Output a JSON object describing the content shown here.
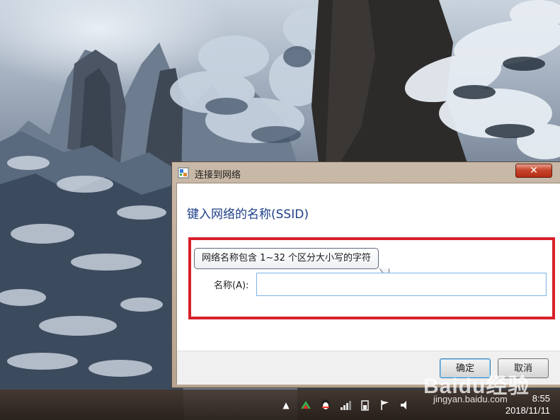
{
  "dialog": {
    "title": "连接到网络",
    "heading": "键入网络的名称(SSID)",
    "tooltip": "网络名称包含 1~32 个区分大小写的字符",
    "name_label": "名称(A):",
    "name_value": "",
    "ok_label": "确定",
    "cancel_label": "取消",
    "close_glyph": "✕"
  },
  "taskbar": {
    "time": "8:55",
    "date": "2018/11/11"
  },
  "watermark": {
    "brand": "Baidu经验",
    "url": "jingyan.baidu.com"
  },
  "colors": {
    "heading": "#1e3f8a",
    "highlight": "#d8202a",
    "close_button": "#c7452c"
  }
}
